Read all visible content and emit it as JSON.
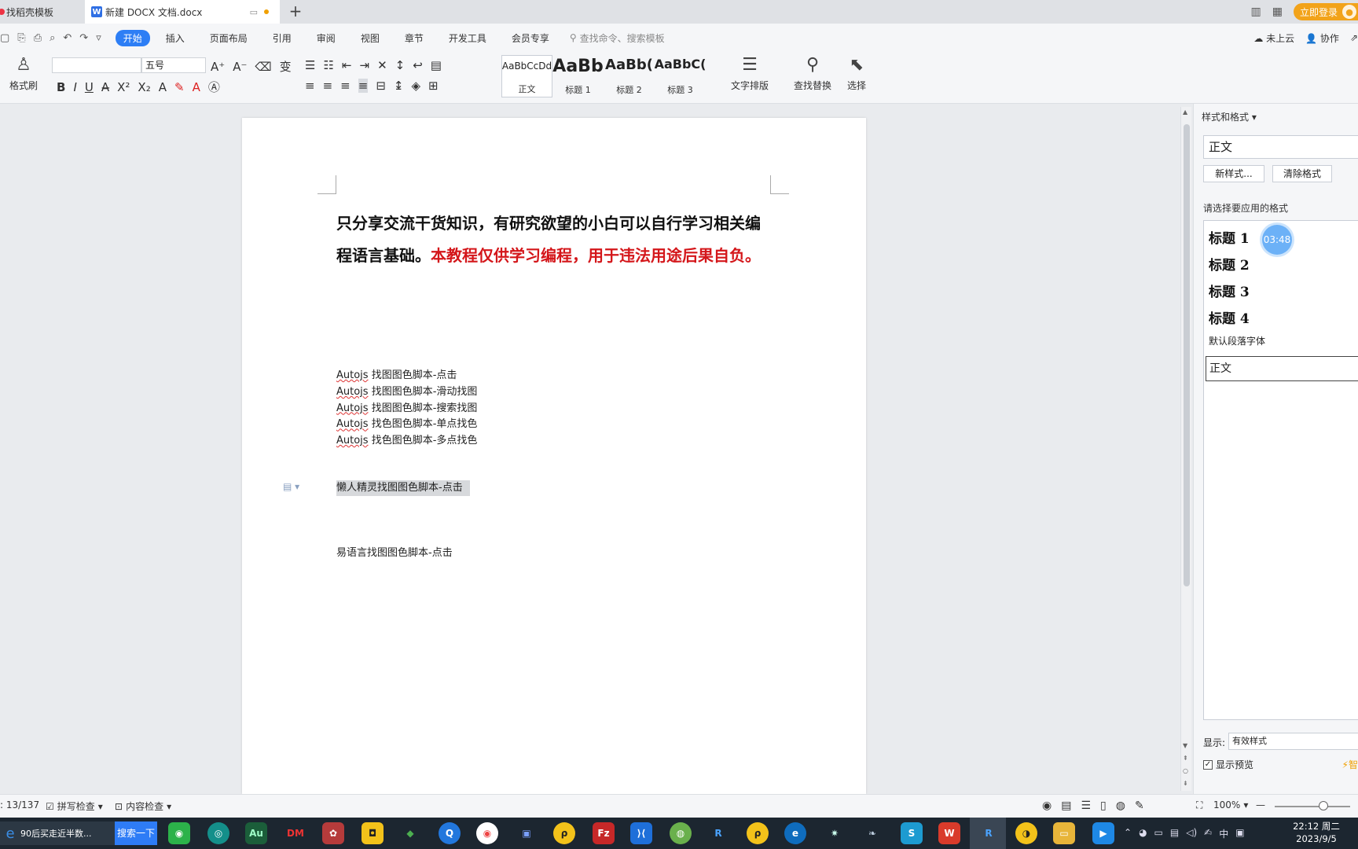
{
  "tabs": [
    {
      "label": "找稻壳模板"
    },
    {
      "label": "新建 DOCX 文档.docx"
    }
  ],
  "titlebar": {
    "login_label": "立即登录"
  },
  "menu": {
    "items": [
      "开始",
      "插入",
      "页面布局",
      "引用",
      "审阅",
      "视图",
      "章节",
      "开发工具",
      "会员专享"
    ],
    "search_placeholder": "查找命令、搜索模板",
    "cloud": "未上云",
    "collab": "协作"
  },
  "ribbon": {
    "format_painter": "格式刷",
    "font_size": "五号",
    "styles": [
      {
        "preview": "AaBbCcDd",
        "name": "正文"
      },
      {
        "preview": "AaBb",
        "name": "标题 1"
      },
      {
        "preview": "AaBb(",
        "name": "标题 2"
      },
      {
        "preview": "AaBbC(",
        "name": "标题 3"
      }
    ],
    "text_layout": "文字排版",
    "find_replace": "查找替换",
    "select": "选择"
  },
  "document": {
    "bold_black": "只分享交流干货知识，有研究欲望的小白可以自行学习相关编程语言基础。",
    "bold_red": "本教程仅供学习编程，用于违法用途后果自负。",
    "autojs_prefix": "Autojs",
    "autojs_lines": [
      "找图图色脚本-点击",
      "找图图色脚本-滑动找图",
      "找图图色脚本-搜索找图",
      "找色图色脚本-单点找色",
      "找色图色脚本-多点找色"
    ],
    "selected_line": "懒人精灵找图图色脚本-点击",
    "last_line": "易语言找图图色脚本-点击"
  },
  "pane": {
    "title": "样式和格式",
    "current_style": "正文",
    "new_style": "新样式...",
    "clear_format": "清除格式",
    "apply_label": "请选择要应用的格式",
    "style_items": [
      "标题 1",
      "标题 2",
      "标题 3",
      "标题 4"
    ],
    "default_font": "默认段落字体",
    "normal": "正文",
    "show_label": "显示:",
    "show_value": "有效样式",
    "preview_label": "显示预览",
    "smart": "智"
  },
  "timer": "03:48",
  "status": {
    "page": ": 13/137",
    "spell": "拼写检查",
    "content_check": "内容检查",
    "zoom": "100%",
    "zoom_level": 0.65
  },
  "taskbar": {
    "search_text": "90后买走近半数...",
    "search_btn": "搜索一下",
    "time": "22:12 周二",
    "date": "2023/9/5",
    "ime": "中"
  },
  "colors": {
    "accent": "#2d7ef5",
    "warning_red": "#d4161a",
    "login": "#f2a31a"
  }
}
